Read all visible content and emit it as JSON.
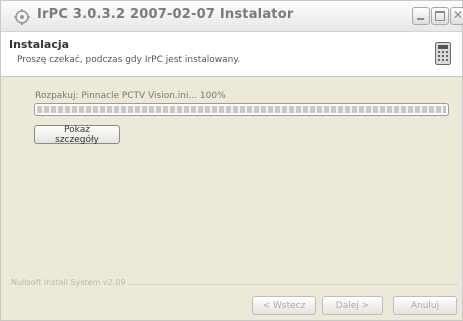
{
  "window": {
    "title": "IrPC 3.0.3.2 2007-02-07 Instalator"
  },
  "header": {
    "title": "Instalacja",
    "subtitle": "Proszę czekać, podczas gdy IrPC jest instalowany."
  },
  "progress": {
    "status_text": "Rozpakuj: Pinnacle PCTV Vision.ini... 100%",
    "percent": 100
  },
  "buttons": {
    "details": "Pokaż szczegóły",
    "back": "< Wstecz",
    "next": "Dalej >",
    "cancel": "Anuluj"
  },
  "footer": {
    "branding": "Nullsoft Install System v2.09"
  },
  "icons": {
    "title_icon": "installer-icon",
    "header_icon": "calculator-icon",
    "minimize": "minimize-icon",
    "maximize": "maximize-icon",
    "close": "close-icon"
  }
}
